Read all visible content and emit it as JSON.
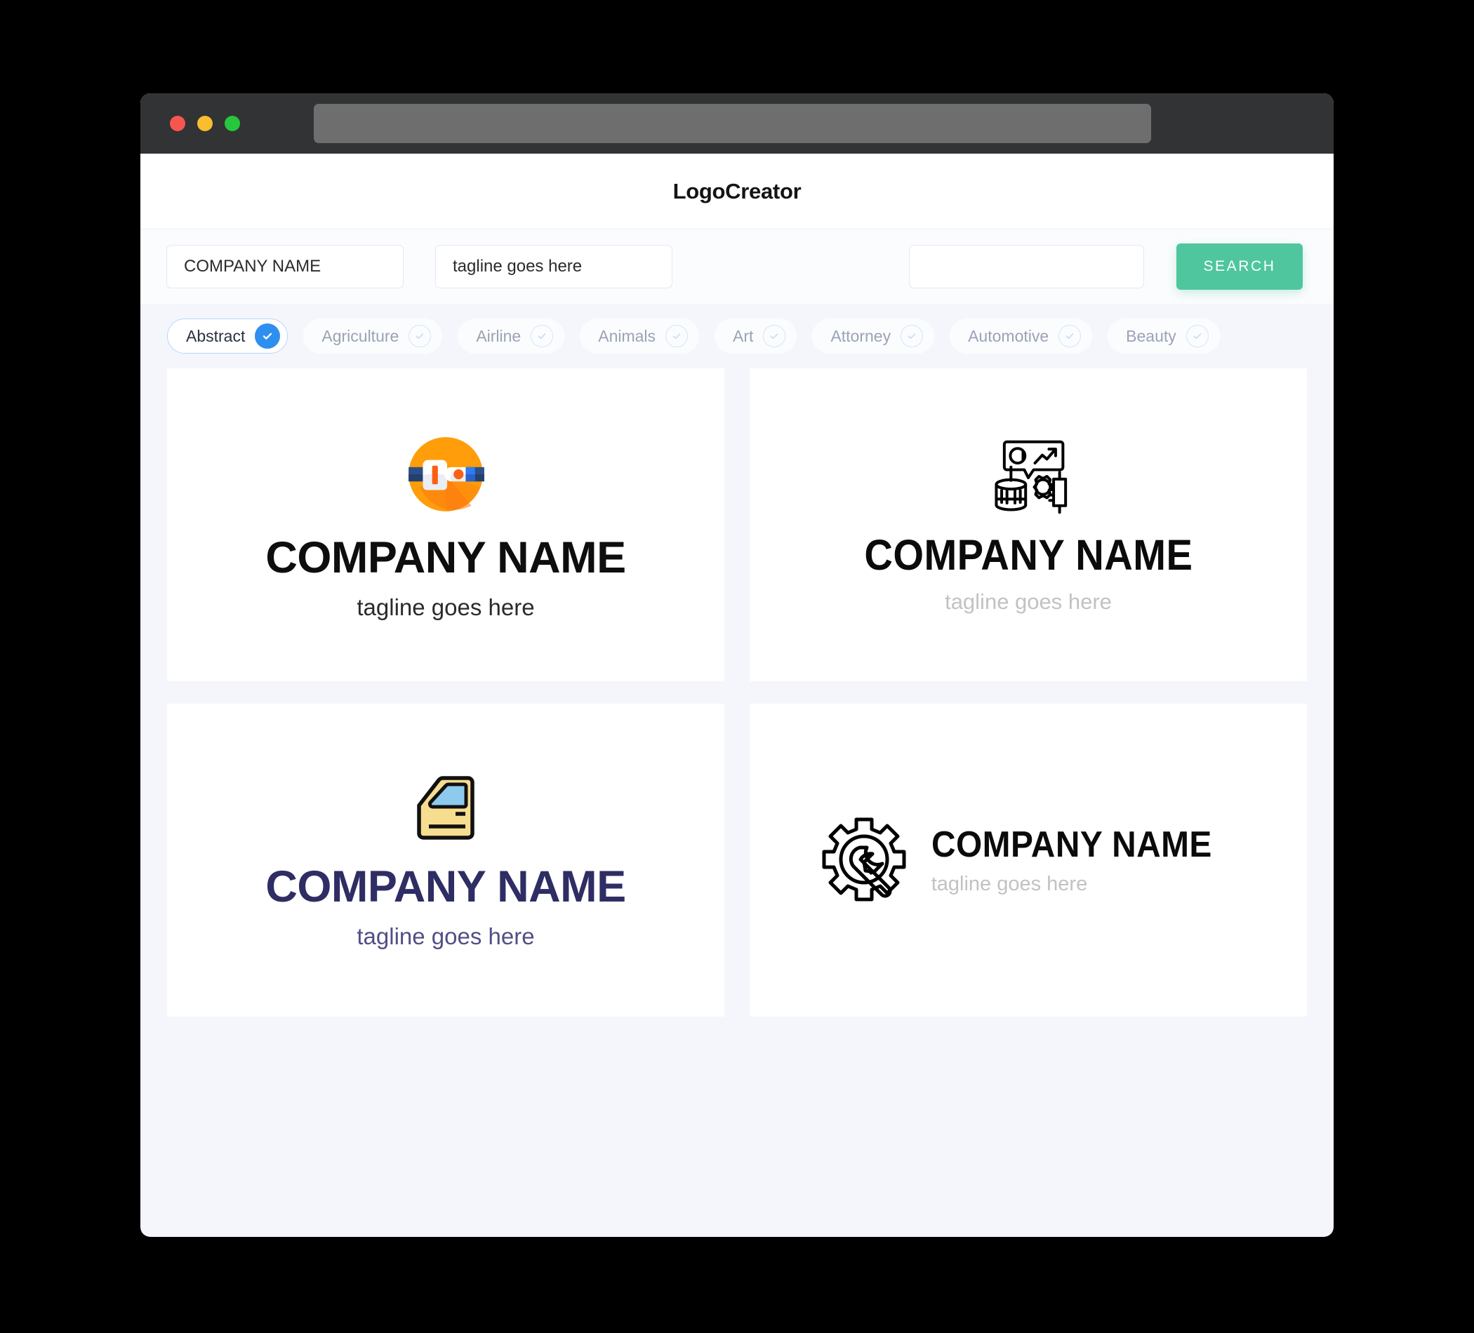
{
  "window": {
    "traffic_lights": [
      {
        "name": "close",
        "color": "#f7564f"
      },
      {
        "name": "minimize",
        "color": "#fabd2f"
      },
      {
        "name": "maximize",
        "color": "#26c73c"
      }
    ],
    "url_value": ""
  },
  "header": {
    "title": "LogoCreator"
  },
  "search": {
    "company_value": "COMPANY NAME",
    "company_placeholder": "COMPANY NAME",
    "tagline_value": "tagline goes here",
    "tagline_placeholder": "tagline goes here",
    "keyword_value": "",
    "keyword_placeholder": "",
    "button_label": "SEARCH",
    "button_color": "#4fc69d"
  },
  "categories": {
    "next_icon": "arrow-right-icon",
    "accent": "#2f8fef",
    "items": [
      {
        "label": "Abstract",
        "selected": true
      },
      {
        "label": "Agriculture",
        "selected": false
      },
      {
        "label": "Airline",
        "selected": false
      },
      {
        "label": "Animals",
        "selected": false
      },
      {
        "label": "Art",
        "selected": false
      },
      {
        "label": "Attorney",
        "selected": false
      },
      {
        "label": "Automotive",
        "selected": false
      },
      {
        "label": "Beauty",
        "selected": false
      }
    ]
  },
  "logos": [
    {
      "icon": "seatbelt-buckle-icon",
      "name": "COMPANY NAME",
      "tagline": "tagline goes here",
      "layout": "vertical",
      "name_color": "#0e0e0e",
      "tagline_color": "#2b2b2b"
    },
    {
      "icon": "engine-gear-chart-icon",
      "name": "COMPANY NAME",
      "tagline": "tagline goes here",
      "layout": "vertical",
      "name_color": "#0b0b0b",
      "tagline_color": "#c2c2c2"
    },
    {
      "icon": "car-door-icon",
      "name": "COMPANY NAME",
      "tagline": "tagline goes here",
      "layout": "vertical",
      "name_color": "#2e2d64",
      "tagline_color": "#514f86"
    },
    {
      "icon": "gear-wrench-icon",
      "name": "COMPANY NAME",
      "tagline": "tagline goes here",
      "layout": "horizontal",
      "name_color": "#0b0b0b",
      "tagline_color": "#c2c2c2"
    }
  ]
}
